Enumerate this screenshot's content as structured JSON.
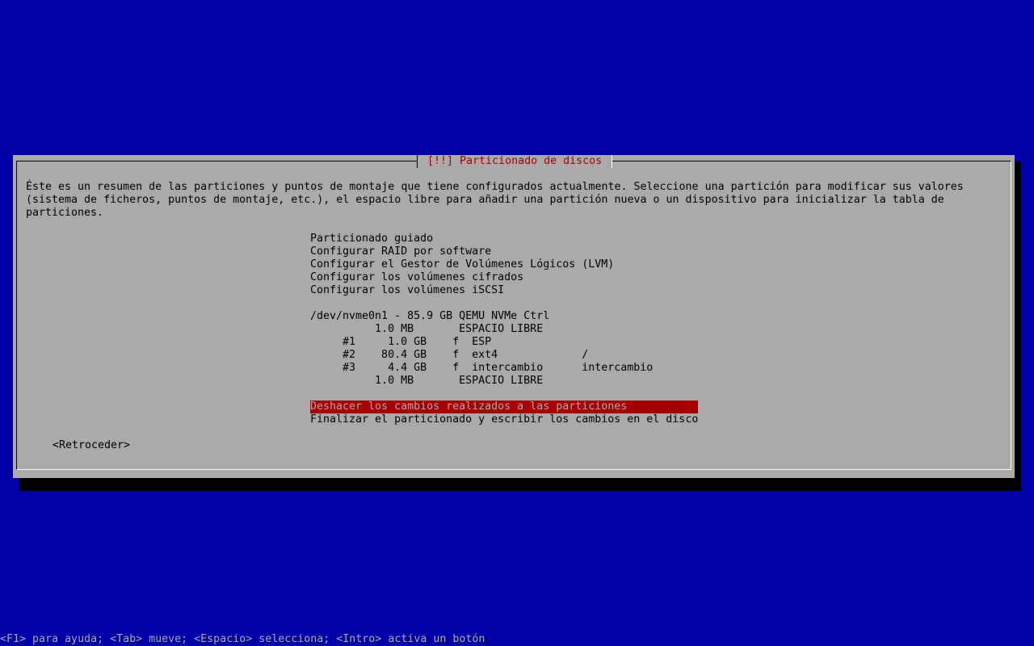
{
  "dialog": {
    "title": "[!!] Particionado de discos",
    "description": [
      "Éste es un resumen de las particiones y puntos de montaje que tiene configurados actualmente. Seleccione una partición para modificar sus valores",
      "(sistema de ficheros, puntos de montaje, etc.), el espacio libre para añadir una partición nueva o un dispositivo para inicializar la tabla de",
      "particiones."
    ],
    "menu_actions": [
      "Particionado guiado",
      "Configurar RAID por software",
      "Configurar el Gestor de Volúmenes Lógicos (LVM)",
      "Configurar los volúmenes cifrados",
      "Configurar los volúmenes iSCSI"
    ],
    "disk": {
      "header": "/dev/nvme0n1 - 85.9 GB QEMU NVMe Ctrl",
      "rows": [
        "          1.0 MB       ESPACIO LIBRE",
        "     #1     1.0 GB    f  ESP",
        "     #2    80.4 GB    f  ext4             /",
        "     #3     4.4 GB    f  intercambio      intercambio",
        "          1.0 MB       ESPACIO LIBRE"
      ]
    },
    "final_actions": [
      "Deshacer los cambios realizados a las particiones",
      "Finalizar el particionado y escribir los cambios en el disco"
    ],
    "selected_index": 0,
    "back_button": "<Retroceder>"
  },
  "status_bar": "<F1> para ayuda; <Tab> mueve; <Espacio> selecciona; <Intro> activa un botón",
  "colors": {
    "background": "#0000a8",
    "dialog": "#aaaaaa",
    "title": "#a80000",
    "selection": "#a80000"
  }
}
